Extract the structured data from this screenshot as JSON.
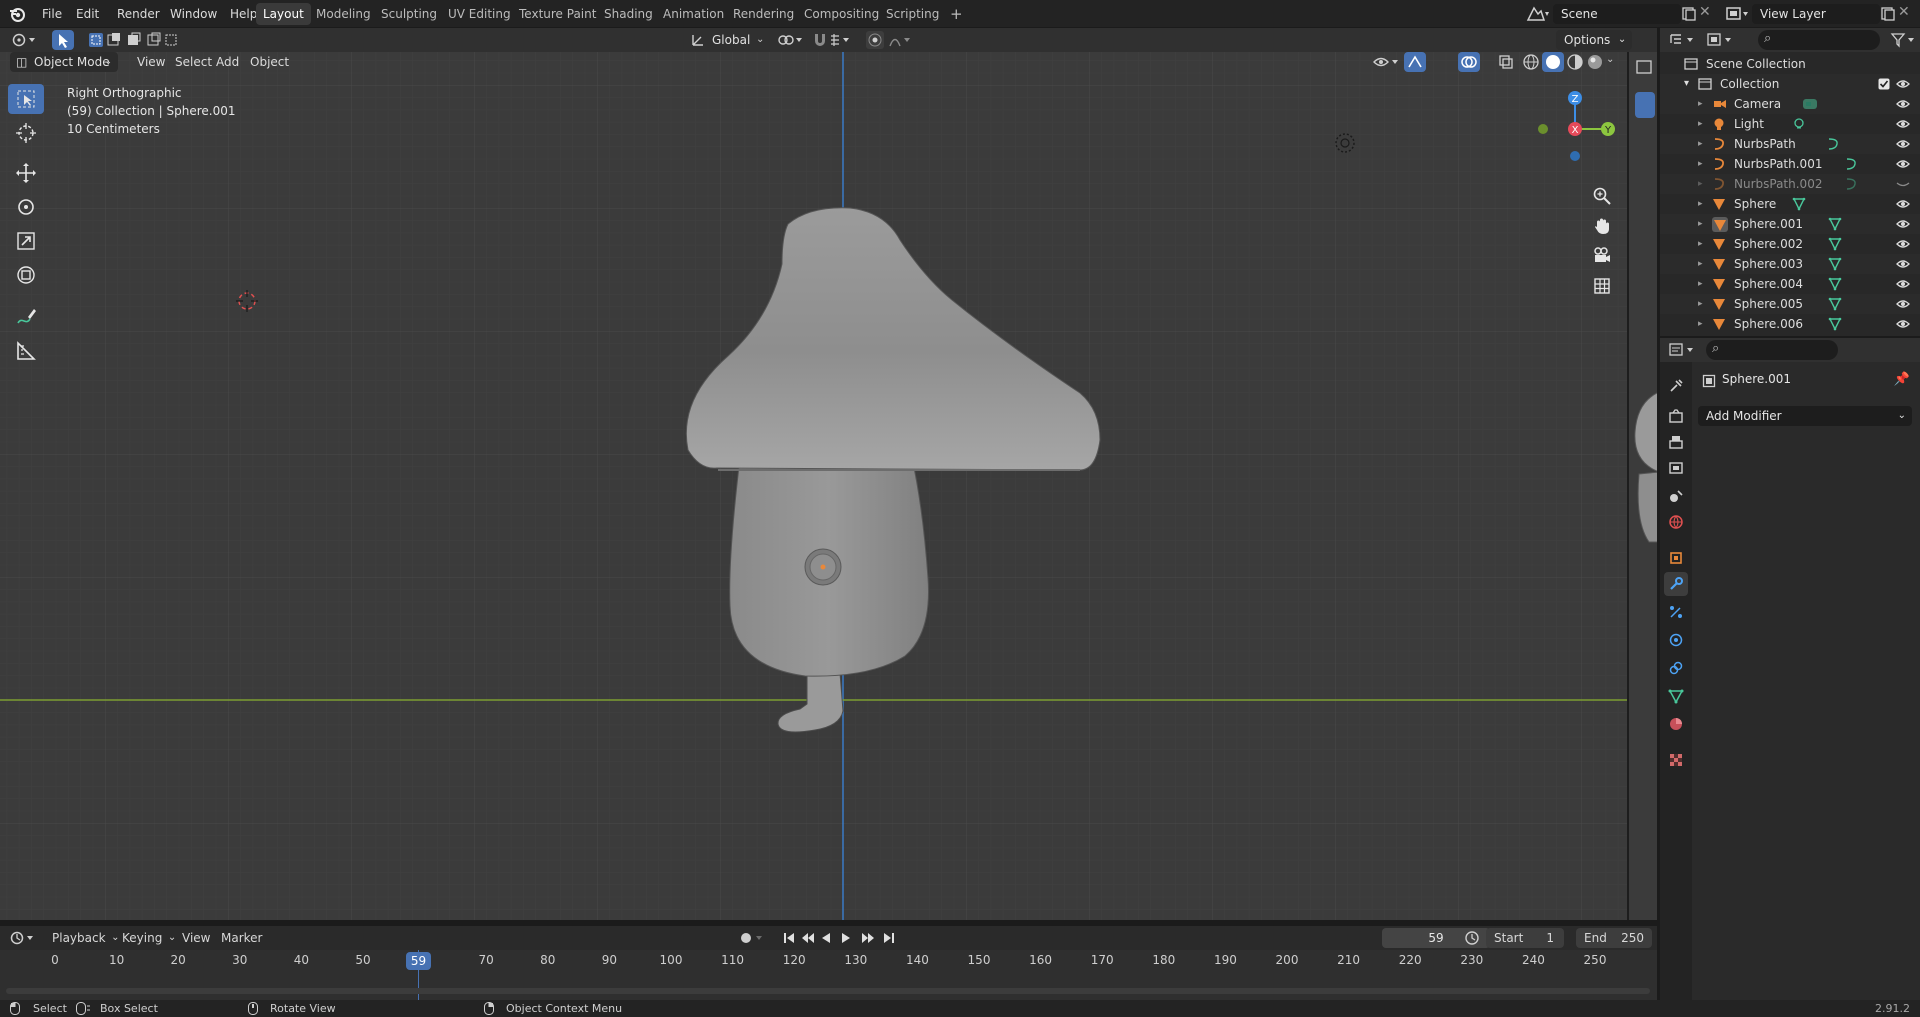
{
  "menubar": {
    "items": [
      "File",
      "Edit",
      "Render",
      "Window",
      "Help"
    ],
    "workspaces": [
      "Layout",
      "Modeling",
      "Sculpting",
      "UV Editing",
      "Texture Paint",
      "Shading",
      "Animation",
      "Rendering",
      "Compositing",
      "Scripting"
    ],
    "active_workspace": "Layout",
    "add_tab": "+",
    "scene": "Scene",
    "view_layer": "View Layer"
  },
  "viewport": {
    "mode": "Object Mode",
    "menus": [
      "View",
      "Select",
      "Add",
      "Object"
    ],
    "transform_orientation": "Global",
    "options": "Options",
    "overlay": {
      "view_name": "Right Orthographic",
      "collection_info": "(59) Collection | Sphere.001",
      "scale": "10 Centimeters"
    },
    "gizmo": {
      "z": "Z",
      "x": "X",
      "y": "Y"
    }
  },
  "outliner": {
    "root": "Scene Collection",
    "collection": "Collection",
    "items": [
      {
        "label": "Camera",
        "type": "camera"
      },
      {
        "label": "Light",
        "type": "light"
      },
      {
        "label": "NurbsPath",
        "type": "curve"
      },
      {
        "label": "NurbsPath.001",
        "type": "curve"
      },
      {
        "label": "NurbsPath.002",
        "type": "curve",
        "hidden": true
      },
      {
        "label": "Sphere",
        "type": "mesh"
      },
      {
        "label": "Sphere.001",
        "type": "mesh",
        "active": true
      },
      {
        "label": "Sphere.002",
        "type": "mesh"
      },
      {
        "label": "Sphere.003",
        "type": "mesh"
      },
      {
        "label": "Sphere.004",
        "type": "mesh"
      },
      {
        "label": "Sphere.005",
        "type": "mesh"
      },
      {
        "label": "Sphere.006",
        "type": "mesh"
      }
    ]
  },
  "properties": {
    "object_name": "Sphere.001",
    "add_modifier": "Add Modifier"
  },
  "timeline": {
    "menus": [
      "Playback",
      "Keying",
      "View",
      "Marker"
    ],
    "current_frame": "59",
    "start_label": "Start",
    "start": "1",
    "end_label": "End",
    "end": "250",
    "ticks": [
      "0",
      "10",
      "20",
      "30",
      "40",
      "50",
      "59",
      "70",
      "80",
      "90",
      "100",
      "110",
      "120",
      "130",
      "140",
      "150",
      "160",
      "170",
      "180",
      "190",
      "200",
      "210",
      "220",
      "230",
      "240",
      "250"
    ]
  },
  "statusbar": {
    "select": "Select",
    "box_select": "Box Select",
    "rotate_view": "Rotate View",
    "context_menu": "Object Context Menu",
    "version": "2.91.2"
  },
  "colors": {
    "accent": "#4772b3",
    "viewport_bg": "#3b3b3b",
    "x_axis": "#e64a5a",
    "y_axis": "#8cc63f",
    "z_axis": "#3d8ee6",
    "object_orange": "#e8883a",
    "mesh_green": "#49c79b"
  }
}
